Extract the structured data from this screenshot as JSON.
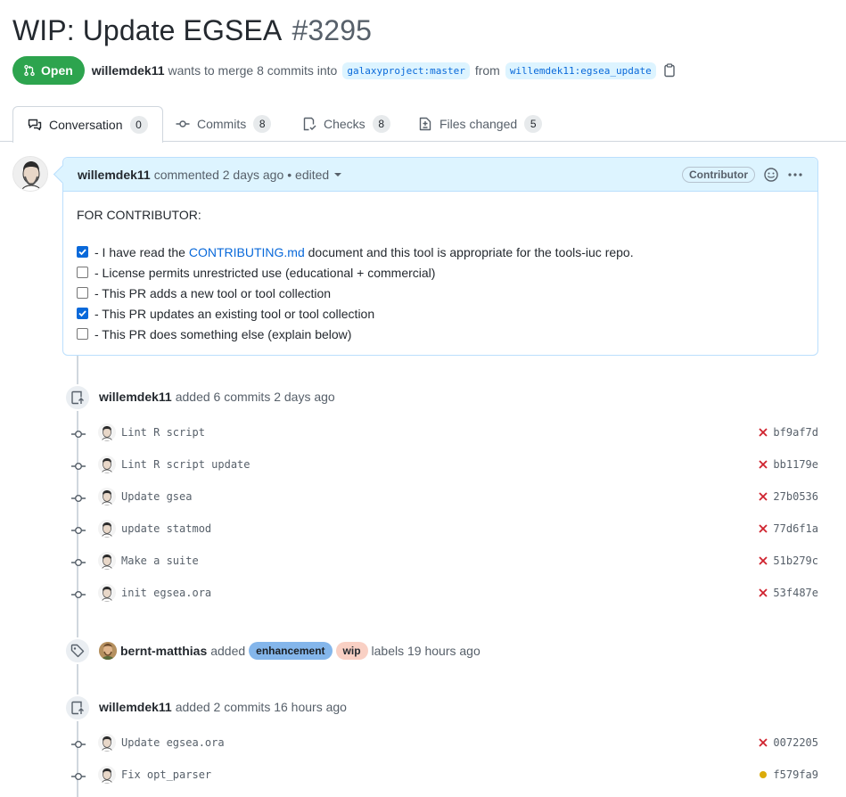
{
  "pr": {
    "title": "WIP: Update EGSEA",
    "number": "#3295",
    "state": "Open",
    "author": "willemdek11",
    "merge_text": "wants to merge 8 commits into",
    "base_branch": "galaxyproject:master",
    "from_text": "from",
    "head_branch": "willemdek11:egsea_update"
  },
  "tabs": [
    {
      "label": "Conversation",
      "count": "0"
    },
    {
      "label": "Commits",
      "count": "8"
    },
    {
      "label": "Checks",
      "count": "8"
    },
    {
      "label": "Files changed",
      "count": "5"
    }
  ],
  "comment": {
    "author": "willemdek11",
    "meta": "commented 2 days ago",
    "edited": "• edited",
    "role": "Contributor",
    "heading": "FOR CONTRIBUTOR:",
    "task_prefix": "- I have read the ",
    "task_link": "CONTRIBUTING.md",
    "task_suffix": " document and this tool is appropriate for the tools-iuc repo.",
    "tasks": [
      {
        "text": "- License permits unrestricted use (educational + commercial)",
        "checked": false
      },
      {
        "text": "- This PR adds a new tool or tool collection",
        "checked": false
      },
      {
        "text": "- This PR updates an existing tool or tool collection",
        "checked": true
      },
      {
        "text": "- This PR does something else (explain below)",
        "checked": false
      }
    ]
  },
  "event1": {
    "author": "willemdek11",
    "text": "added 6 commits 2 days ago",
    "commits": [
      {
        "msg": "Lint R script",
        "sha": "bf9af7d",
        "status": "failure"
      },
      {
        "msg": "Lint R script update",
        "sha": "bb1179e",
        "status": "failure"
      },
      {
        "msg": "Update gsea",
        "sha": "27b0536",
        "status": "failure"
      },
      {
        "msg": "update statmod",
        "sha": "77d6f1a",
        "status": "failure"
      },
      {
        "msg": "Make a suite",
        "sha": "51b279c",
        "status": "failure"
      },
      {
        "msg": "init egsea.ora",
        "sha": "53f487e",
        "status": "failure"
      }
    ]
  },
  "event2": {
    "author": "bernt-matthias",
    "added": "added",
    "labels": [
      {
        "name": "enhancement",
        "color": "#84b6eb",
        "text_color": "#1b1f24"
      },
      {
        "name": "wip",
        "color": "#f9d0c4",
        "text_color": "#24292f"
      }
    ],
    "suffix": "labels 19 hours ago"
  },
  "event3": {
    "author": "willemdek11",
    "text": "added 2 commits 16 hours ago",
    "commits": [
      {
        "msg": "Update egsea.ora",
        "sha": "0072205",
        "status": "failure"
      },
      {
        "msg": "Fix opt_parser",
        "sha": "f579fa9",
        "status": "pending"
      }
    ]
  },
  "colors": {
    "open_green": "#2da44e",
    "failure_red": "#cf222e",
    "pending_yellow": "#bf8700",
    "link_blue": "#0969da"
  }
}
